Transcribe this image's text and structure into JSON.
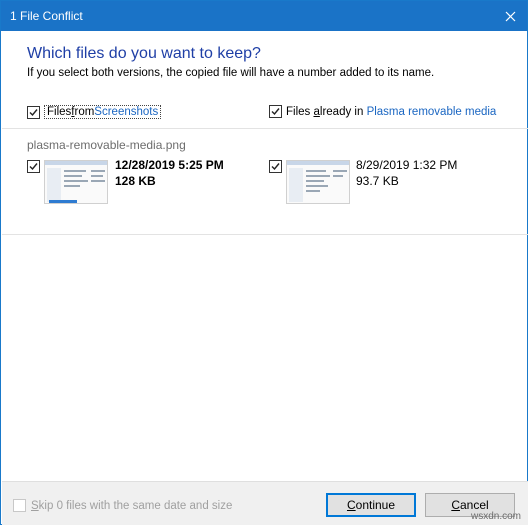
{
  "window": {
    "title": "1 File Conflict",
    "accent": "#1a73c7"
  },
  "prompt": {
    "heading": "Which files do you want to keep?",
    "subtext": "If you select both versions, the copied file will have a number added to its name."
  },
  "columns": {
    "left": {
      "prefix": "Files ",
      "prefix_ul": "f",
      "prefix_rest": "rom ",
      "source": "Screenshots",
      "checked": true
    },
    "right": {
      "prefix": "Files ",
      "prefix_ul": "a",
      "prefix_rest": "lready in ",
      "source": "Plasma removable media",
      "checked": true
    }
  },
  "file": {
    "name": "plasma-removable-media.png",
    "left": {
      "date": "12/28/2019 5:25 PM",
      "size": "128 KB",
      "checked": true
    },
    "right": {
      "date": "8/29/2019 1:32 PM",
      "size": "93.7 KB",
      "checked": true
    }
  },
  "footer": {
    "skip_ul": "S",
    "skip_rest": "kip 0 files with the same date and size",
    "skip_checked": false,
    "continue_ul": "C",
    "continue_rest": "ontinue",
    "cancel_ul": "C",
    "cancel_rest": "ancel"
  },
  "watermark": "wsxdn.com"
}
